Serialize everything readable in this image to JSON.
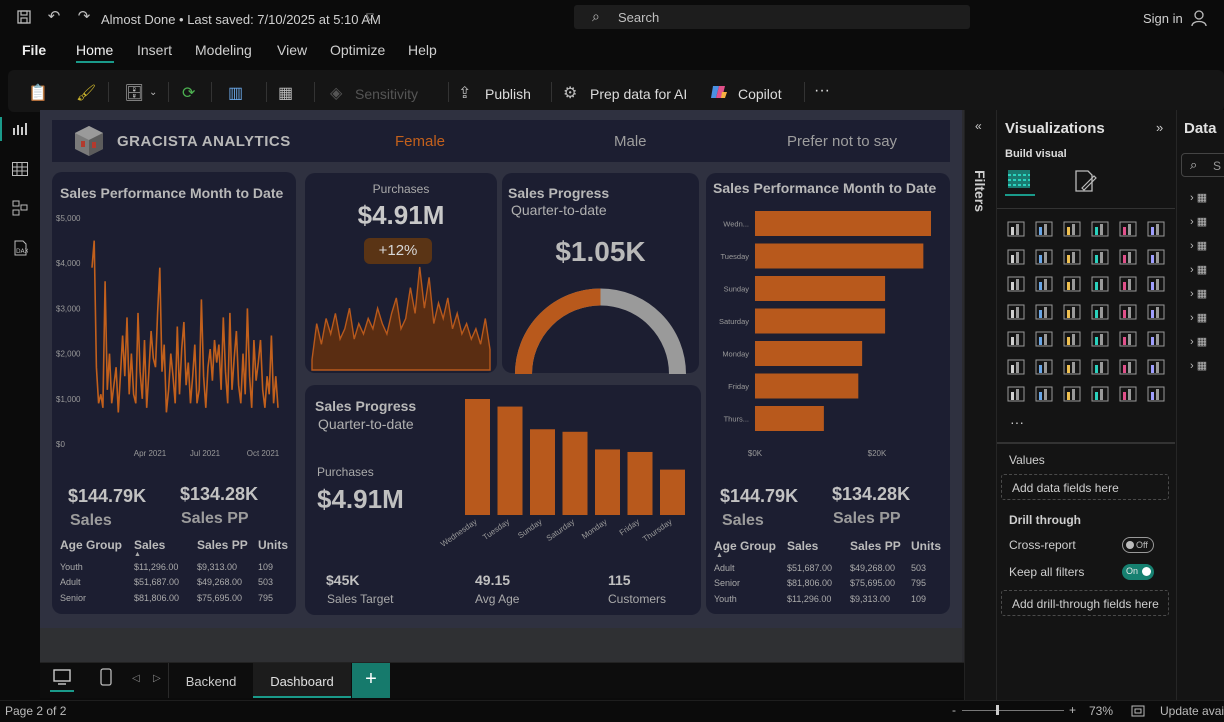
{
  "titlebar": {
    "doc_title": "Almost Done • Last saved: 7/10/2025 at 5:10 AM",
    "search_label": "Search",
    "signin": "Sign in"
  },
  "menu": [
    "File",
    "Home",
    "Insert",
    "Modeling",
    "View",
    "Optimize",
    "Help"
  ],
  "ribbon": {
    "sensitivity": "Sensitivity",
    "publish": "Publish",
    "prep_data": "Prep data for AI",
    "copilot": "Copilot",
    "more": "···"
  },
  "report": {
    "brand": "GRACISTA ANALYTICS",
    "slicers": [
      "Female",
      "Male",
      "Prefer not to say"
    ],
    "line_card": {
      "title": "Sales Performance Month to Date",
      "y_ticks": [
        "$5,000",
        "$4,000",
        "$3,000",
        "$2,000",
        "$1,000",
        "$0"
      ],
      "x_ticks": [
        "Apr 2021",
        "Jul 2021",
        "Oct 2021"
      ],
      "kpi_sales": "$144.79K",
      "kpi_sales_lbl": "Sales",
      "kpi_pp": "$134.28K",
      "kpi_pp_lbl": "Sales PP",
      "table_headers": [
        "Age Group",
        "Sales",
        "Sales PP",
        "Units"
      ],
      "table_rows": [
        [
          "Youth",
          "$11,296.00",
          "$9,313.00",
          "109"
        ],
        [
          "Adult",
          "$51,687.00",
          "$49,268.00",
          "503"
        ],
        [
          "Senior",
          "$81,806.00",
          "$75,695.00",
          "795"
        ]
      ]
    },
    "purchases_card": {
      "label": "Purchases",
      "value": "$4.91M",
      "badge": "+12%"
    },
    "progress_card": {
      "title": "Sales Progress",
      "subtitle": "Quarter-to-date",
      "value": "$1.05K",
      "gauge_fraction": 0.5
    },
    "bottom_card": {
      "title": "Sales Progress",
      "subtitle": "Quarter-to-date",
      "purch_label": "Purchases",
      "purch_value": "$4.91M",
      "stats": [
        {
          "value": "$45K",
          "label": "Sales Target"
        },
        {
          "value": "49.15",
          "label": "Avg Age"
        },
        {
          "value": "115",
          "label": "Customers"
        }
      ]
    },
    "hbar_card": {
      "title": "Sales Performance Month to Date",
      "x_ticks": [
        "$0K",
        "$20K"
      ],
      "kpi_sales": "$144.79K",
      "kpi_sales_lbl": "Sales",
      "kpi_pp": "$134.28K",
      "kpi_pp_lbl": "Sales PP",
      "table_headers": [
        "Age Group",
        "Sales",
        "Sales PP",
        "Units"
      ],
      "table_rows": [
        [
          "Adult",
          "$51,687.00",
          "$49,268.00",
          "503"
        ],
        [
          "Senior",
          "$81,806.00",
          "$75,695.00",
          "795"
        ],
        [
          "Youth",
          "$11,296.00",
          "$9,313.00",
          "109"
        ]
      ]
    }
  },
  "chart_data": [
    {
      "type": "line",
      "title": "Sales Performance Month to Date",
      "ylim": [
        0,
        5000
      ],
      "x_ticks": [
        "Apr 2021",
        "Jul 2021",
        "Oct 2021"
      ],
      "series": [
        {
          "values": [
            3900,
            4500,
            1700,
            900,
            1100,
            800,
            3600,
            1200,
            2000,
            900,
            1300,
            1700,
            700,
            1500,
            2400,
            1500,
            2800,
            1100,
            2000,
            1100,
            900,
            2900,
            1600,
            1000,
            2300,
            800,
            1600,
            2500,
            1900,
            1700,
            2900,
            3900,
            1600,
            2200,
            700,
            1200,
            2000,
            1500,
            900,
            2600,
            1100,
            2100,
            2700,
            1300,
            1800,
            900,
            1500,
            2200,
            900,
            1200,
            3200,
            1500,
            800,
            1700,
            2100,
            1400,
            2300,
            1800,
            2200,
            1200,
            2800,
            1600,
            900,
            2900,
            1200,
            1900,
            2500,
            1300,
            900,
            2000,
            1100,
            3000,
            1500,
            800,
            2300,
            1400,
            1800,
            2300,
            1200,
            800,
            1500,
            1100,
            2400,
            900,
            1500,
            800
          ]
        }
      ]
    },
    {
      "type": "area",
      "title": "Purchases",
      "series": [
        {
          "values": [
            10,
            45,
            25,
            50,
            35,
            55,
            30,
            40,
            60,
            30,
            45,
            35,
            50,
            40,
            60,
            45,
            35,
            55,
            70,
            40,
            50,
            80,
            55,
            100,
            60,
            90,
            45,
            65,
            50,
            70,
            40,
            55,
            35,
            45,
            30,
            40,
            25,
            50,
            20
          ]
        }
      ]
    },
    {
      "type": "bar",
      "categories": [
        "Wednesday",
        "Tuesday",
        "Sunday",
        "Saturday",
        "Monday",
        "Friday",
        "Thursday"
      ],
      "values": [
        23,
        21.5,
        17,
        16.5,
        13,
        12.5,
        9
      ]
    },
    {
      "type": "bar",
      "orientation": "horizontal",
      "title": "Sales Performance Month to Date",
      "categories": [
        "Wedn...",
        "Tuesday",
        "Sunday",
        "Saturday",
        "Monday",
        "Friday",
        "Thurs..."
      ],
      "values": [
        23,
        22,
        17,
        17,
        14,
        13.5,
        9
      ],
      "x_ticks": [
        "$0K",
        "$20K"
      ]
    }
  ],
  "viz_pane": {
    "title": "Visualizations",
    "build_visual": "Build visual",
    "values_label": "Values",
    "values_well": "Add data fields here",
    "drill_through": "Drill through",
    "cross_report": "Cross-report",
    "cross_report_state": "Off",
    "keep_filters": "Keep all filters",
    "keep_filters_state": "On",
    "drill_well": "Add drill-through fields here",
    "more": "···"
  },
  "filters_label": "Filters",
  "data_pane": {
    "title": "Data",
    "search": "S"
  },
  "tabs": {
    "backend": "Backend",
    "dashboard": "Dashboard",
    "add": "+"
  },
  "status": {
    "page": "Page 2 of 2",
    "zoom": "73%",
    "update": "Update avai",
    "minus": "-",
    "plus": "+"
  },
  "colors": {
    "accent": "#c2601c",
    "teal": "#1a9a8a",
    "card": "#1c1e31",
    "gauge_rest": "#9a9a9a"
  }
}
